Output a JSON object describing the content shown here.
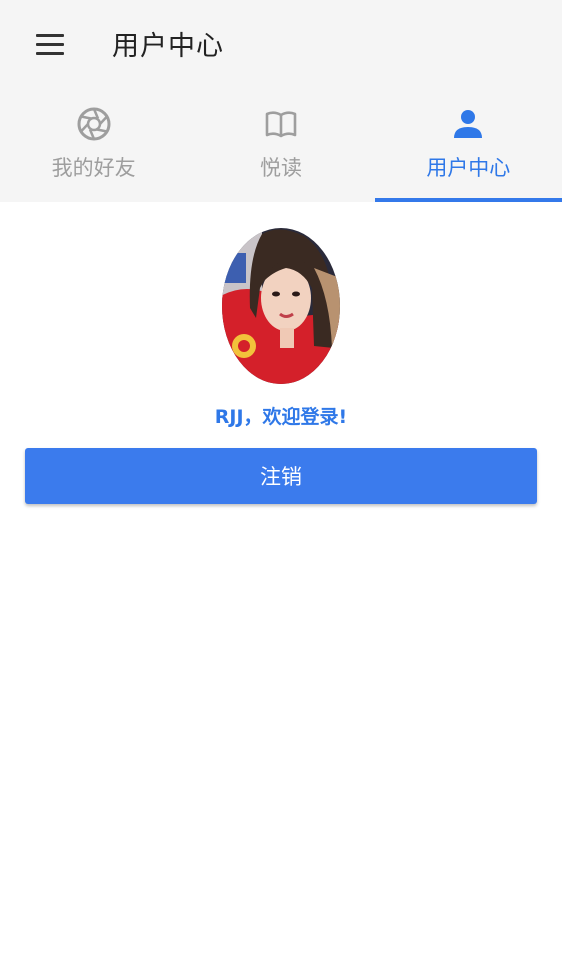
{
  "header": {
    "menu_icon": "hamburger-menu-icon",
    "title": "用户中心"
  },
  "tabs": [
    {
      "label": "我的好友",
      "icon": "aperture-icon",
      "active": false
    },
    {
      "label": "悦读",
      "icon": "open-book-icon",
      "active": false
    },
    {
      "label": "用户中心",
      "icon": "person-icon",
      "active": true
    }
  ],
  "profile": {
    "avatar": "user-avatar-photo",
    "welcome": "RJJ，欢迎登录!"
  },
  "actions": {
    "logout_label": "注销"
  },
  "colors": {
    "accent": "#2f78e8",
    "button": "#3b7bed",
    "bar_bg": "#f5f5f5",
    "inactive": "#9e9e9e"
  }
}
